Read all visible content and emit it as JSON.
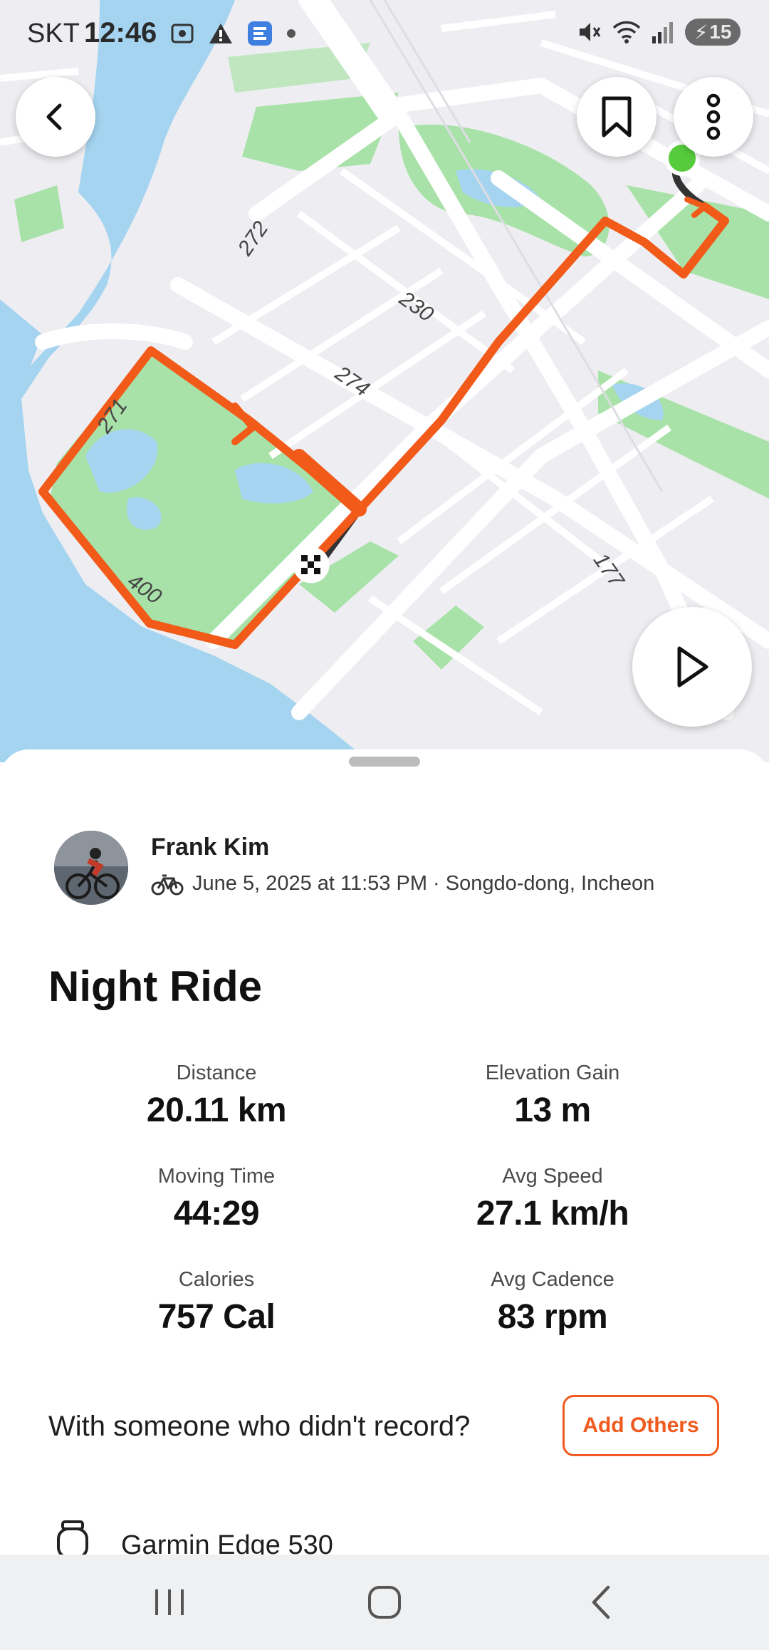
{
  "status_bar": {
    "carrier": "SKT",
    "time": "12:46",
    "battery": "15",
    "icons": [
      "screenshot-icon",
      "warning-icon",
      "app-notification-icon",
      "dot-icon",
      "mute-icon",
      "wifi-icon",
      "signal-icon",
      "battery-icon"
    ]
  },
  "map": {
    "route_labels": [
      "272",
      "230",
      "274",
      "271",
      "400",
      "177"
    ],
    "colors": {
      "water": "#a5d4f0",
      "land": "#eeeef2",
      "park": "#a8e2a8",
      "road": "#ffffff",
      "route": "#f15a19",
      "start": "#56cc3c"
    },
    "buttons": [
      "back-icon",
      "bookmark-icon",
      "more-icon",
      "play-icon"
    ]
  },
  "activity": {
    "athlete_name": "Frank Kim",
    "meta": "June 5, 2025 at 11:53 PM · Songdo-dong, Incheon",
    "title": "Night Ride",
    "stats": [
      {
        "label": "Distance",
        "value": "20.11 km"
      },
      {
        "label": "Elevation Gain",
        "value": "13 m"
      },
      {
        "label": "Moving Time",
        "value": "44:29"
      },
      {
        "label": "Avg Speed",
        "value": "27.1 km/h"
      },
      {
        "label": "Calories",
        "value": "757 Cal"
      },
      {
        "label": "Avg Cadence",
        "value": "83 rpm"
      }
    ],
    "with_others_text": "With someone who didn't record?",
    "add_others_label": "Add Others",
    "device": "Garmin Edge 530"
  },
  "nav_bar": {
    "buttons": [
      "recents-icon",
      "home-icon",
      "back-nav-icon"
    ]
  }
}
